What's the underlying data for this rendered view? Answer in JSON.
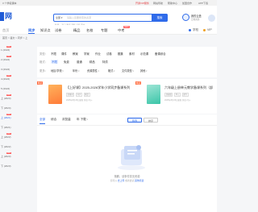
{
  "topbar": {
    "left": "3 个学段课本",
    "links": [
      "开通VIP服务",
      "网站导航",
      "帮助中心",
      "加盟合作",
      "APP下载"
    ],
    "vip_label": "开通VIP服务"
  },
  "header": {
    "logo_char": "网",
    "search_select": "全部 ▾",
    "search_placeholder": "请输入您要搜索的资源",
    "search_button": "搜索",
    "hot_words": "热搜：  复习  教案  课件  试卷  期中",
    "cloud_label": "我的云盘",
    "cloud_sub": "云端资源"
  },
  "nav": {
    "home": "首页",
    "items": [
      "同步",
      "知识点",
      "试卷",
      "精品",
      "名校",
      "专题",
      "中考"
    ],
    "new_badge": "NEW",
    "right_items": [
      "学校",
      "VIP"
    ]
  },
  "breadcrumb": "首页 > 语文 > 同步 > 上",
  "sidebar": {
    "items": [
      {
        "label": "1 (2024)",
        "tag": "new"
      },
      {
        "label": "2 (2024)",
        "tag": "new"
      },
      {
        "label": "3 (2024)",
        "tag": ""
      },
      {
        "label": "4 (2024)",
        "tag": "new"
      },
      {
        "label": "5 (2024)",
        "tag": ""
      },
      {
        "label": "上 (2024)",
        "tag": "new"
      },
      {
        "label": "下 (2024)",
        "tag": ""
      },
      {
        "label": "上 (2021)",
        "tag": "new"
      },
      {
        "label": "下 (2021)",
        "tag": ""
      },
      {
        "label": "上 (2022)",
        "tag": "new"
      },
      {
        "label": "下 (2022)",
        "tag": ""
      },
      {
        "label": "上 (2023)",
        "tag": "new"
      },
      {
        "label": "下 (2023)",
        "tag": ""
      }
    ]
  },
  "filters": {
    "type_label": "类型：",
    "types": [
      "不限",
      "课件",
      "教案",
      "学案",
      "作业",
      "试卷",
      "题集",
      "素材",
      "示范课",
      "备课综合"
    ],
    "format_label": "格式：",
    "formats": [
      "不限",
      "免费",
      "普通",
      "精品",
      "特供"
    ],
    "more_label": "更多：",
    "dropdowns": [
      "地区/学校",
      "年份",
      "资源属性",
      "格式",
      "文件类型",
      "其他"
    ]
  },
  "featured": [
    {
      "badge": "精选",
      "title": "【上好课】2025-2026学年小学同步备课系列",
      "tags": [
        "新教材",
        "同步",
        "教案"
      ],
      "meta": "2025年8月26日更新  浏览 3万+"
    },
    {
      "badge": "精选",
      "title": "六年级上册单元教学备课系列（部",
      "tags": [
        "部编版",
        "单元",
        "课件"
      ],
      "meta": "2025年8月26日更新  浏览 2万+"
    }
  ],
  "list": {
    "tabs": [
      "全部",
      "综合",
      "浏览量",
      "年 下载"
    ],
    "btn_a": "筛选",
    "btn_b": "排序"
  },
  "empty": {
    "title": "抱歉，该条件暂无资源",
    "sub_prefix": "您可以",
    "sub_link1": "去上传",
    "sub_mid": "或者尝试",
    "sub_link2": "其他筛选"
  },
  "colors": {
    "brand": "#2f6bea",
    "badge": "#ff5b5b",
    "featured_badge": "#ff6a3c"
  }
}
